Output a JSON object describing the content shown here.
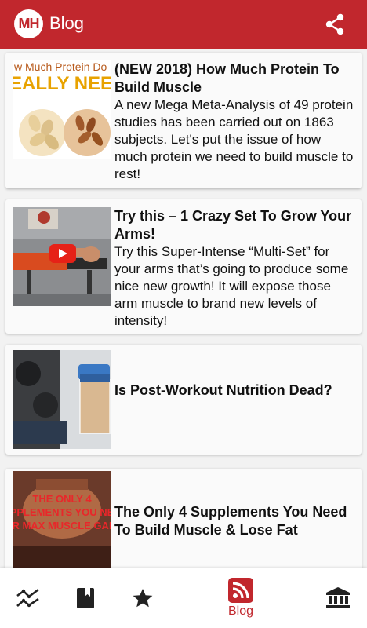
{
  "appbar": {
    "logo_text": "MH",
    "title": "Blog",
    "share_icon": "share-icon"
  },
  "posts": [
    {
      "title": "(NEW 2018) How Much Protein To Build Muscle",
      "description": "A new Mega Meta-Analysis of 49 protein studies has been carried out on 1863 subjects. Let's put the issue of how much protein we need to build muscle to rest!",
      "thumb_text_top": "w Much Protein Do",
      "thumb_text_big": "EALLY NEED"
    },
    {
      "title": "Try this – 1 Crazy Set To Grow Your Arms!",
      "description": "Try this Super-Intense “Multi-Set” for your arms that’s going to produce some nice new growth! It will expose those arm muscle to brand new levels of intensity!"
    },
    {
      "title": "Is Post-Workout Nutrition Dead?",
      "description": ""
    },
    {
      "title": "The Only 4 Supplements You Need To Build Muscle & Lose Fat",
      "description": "",
      "thumb_text": [
        "THE ONLY 4",
        "PPLEMENTS YOU NE",
        "R MAX MUSCLE GAI"
      ]
    }
  ],
  "bottom_nav": {
    "items": [
      {
        "icon": "trending-icon",
        "label": ""
      },
      {
        "icon": "book-icon",
        "label": ""
      },
      {
        "icon": "star-icon",
        "label": ""
      },
      {
        "icon": "rss-icon",
        "label": "Blog",
        "active": true
      },
      {
        "icon": "bank-icon",
        "label": ""
      }
    ]
  },
  "colors": {
    "brand": "#c1272d",
    "card_bg": "#fafafa",
    "page_bg": "#f2f2f2"
  }
}
